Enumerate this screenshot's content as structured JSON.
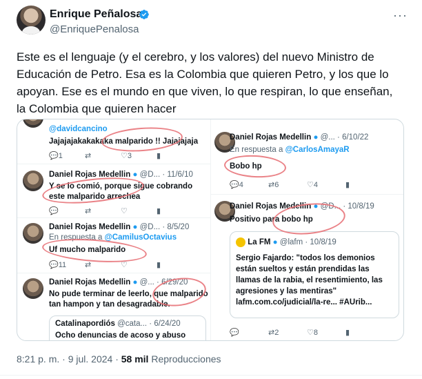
{
  "author": {
    "name": "Enrique Peñalosa",
    "handle": "@EnriquePenalosa"
  },
  "tweet_text": "Este es el lenguaje (y el cerebro, y los valores) del nuevo Ministro de Educación de Petro. Esa es la Colombia que quieren Petro, y los que lo apoyan. Ese es el mundo en que viven, lo que respiran, lo que enseñan, la Colombia que quieren hacer",
  "media": {
    "left": [
      {
        "mention": "@davidcancino",
        "text": "Jajajajakakakaka malparido !! Jajajajaja",
        "actions": [
          "1",
          "",
          "3",
          ""
        ]
      },
      {
        "name": "Daniel Rojas Medellin",
        "meta": "@D... · 11/6/10",
        "text": "Y se lo comió, porque sigue cobrando este malparido arrechea",
        "actions": [
          "",
          "",
          "",
          ""
        ]
      },
      {
        "name": "Daniel Rojas Medellin",
        "meta": "@D... · 8/5/20",
        "reply_prefix": "En respuesta a",
        "reply_to": "@CamilusOctavius",
        "text": "Uf mucho malparido",
        "actions": [
          "11",
          "",
          "",
          ""
        ]
      },
      {
        "name": "Daniel Rojas Medellin",
        "meta": "@... · 6/29/20",
        "text": "No pude terminar de leerlo, que malparido tan hampon y tan desagradable.",
        "quote": {
          "name": "Catalinapordiós",
          "meta": "@cata... · 6/24/20",
          "text": "Ocho denuncias de acoso y abuso"
        }
      }
    ],
    "right": [
      {
        "name": "Daniel Rojas Medellin",
        "meta": "@... · 6/10/22",
        "reply_prefix": "En respuesta a",
        "reply_to": "@CarlosAmayaR",
        "text": "Bobo hp",
        "actions": [
          "4",
          "6",
          "4",
          ""
        ]
      },
      {
        "name": "Daniel Rojas Medellin",
        "meta": "@D... · 10/8/19",
        "text": "Positivo para bobo hp",
        "quote": {
          "name": "La FM",
          "meta": "@lafm · 10/8/19",
          "text": "Sergio Fajardo: \"todos los demonios están sueltos y están prendidas las llamas de la rabia, el resentimiento, las agresiones y las mentiras\" lafm.com.co/judicial/la-re... #AUrib..."
        },
        "actions": [
          "",
          "2",
          "8",
          ""
        ]
      }
    ]
  },
  "footer": {
    "time": "8:21 p. m. · 9 jul. 2024 · ",
    "views": "58 mil",
    "views_label": " Reproducciones"
  },
  "colors": {
    "accent": "#1d9bf0",
    "circle": "#e8747a",
    "secondary_text": "#536471"
  },
  "icons": [
    "verified-badge-icon",
    "more-icon",
    "reply-icon",
    "retweet-icon",
    "like-icon",
    "views-icon",
    "lafm-logo"
  ]
}
